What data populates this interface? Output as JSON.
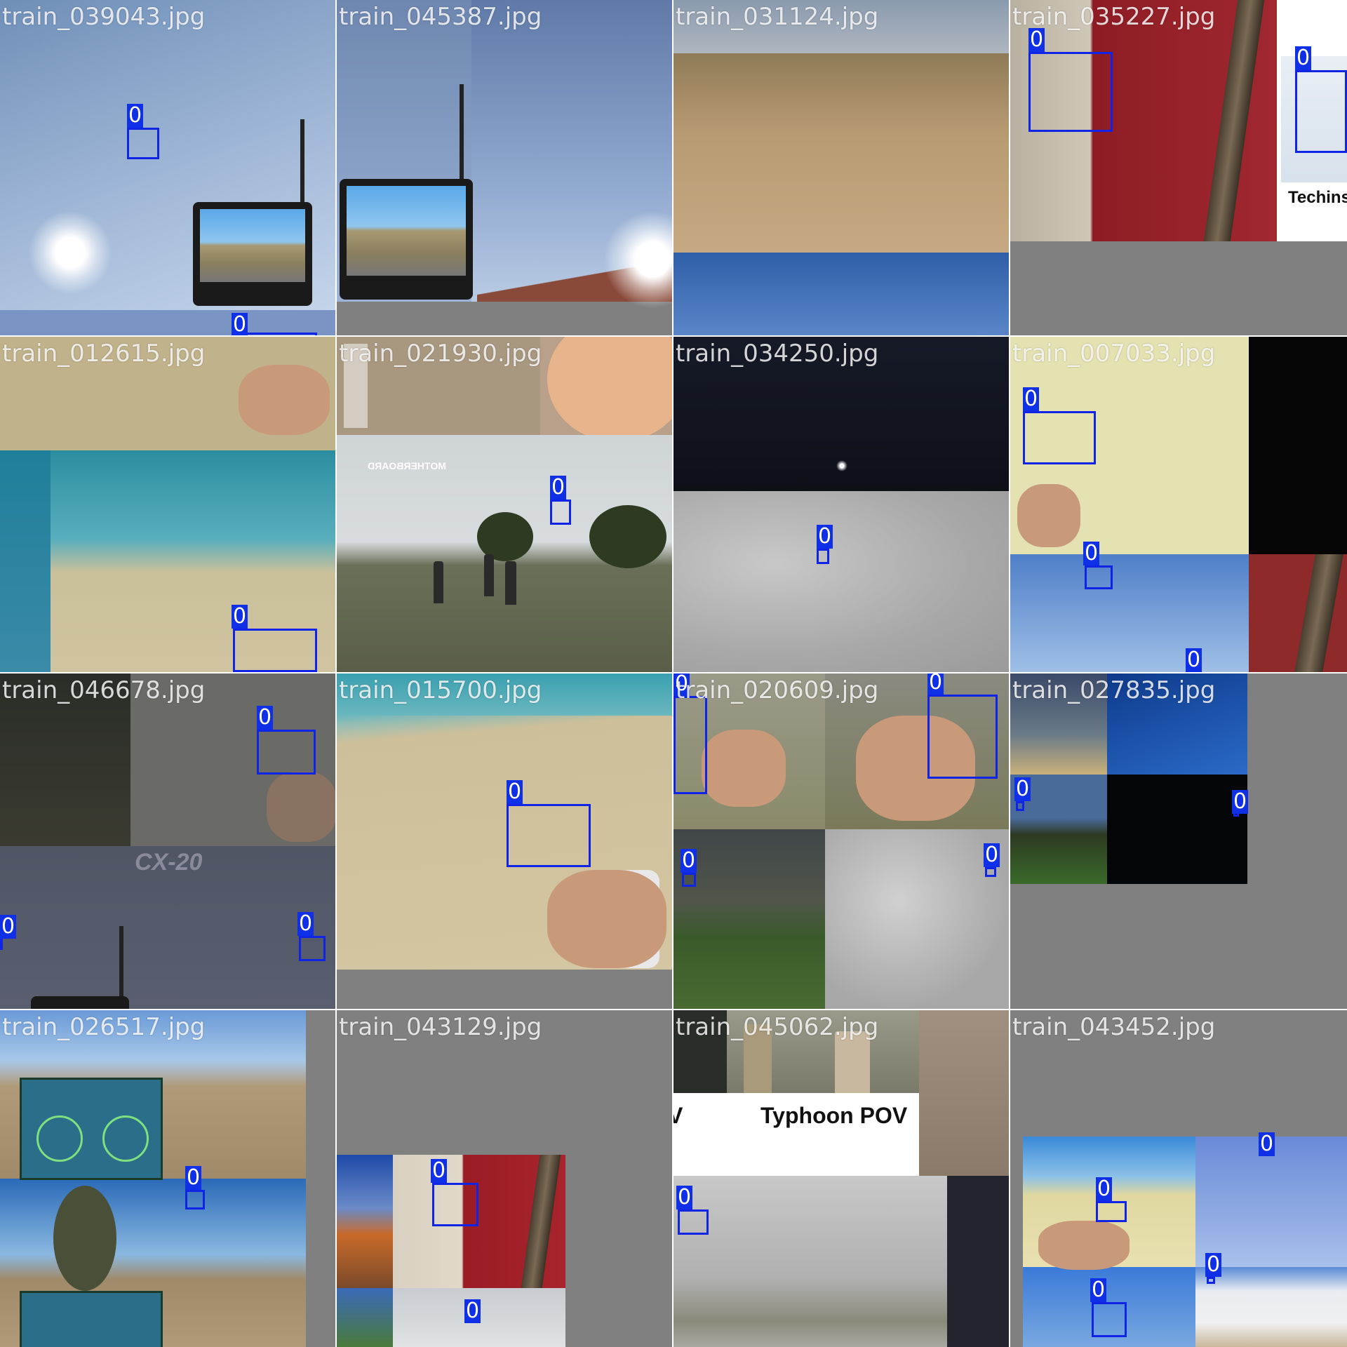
{
  "mosaic": {
    "box_color": "#1024e6",
    "tiles": [
      {
        "filename": "train_039043.jpg",
        "labels": [
          "0",
          "0"
        ]
      },
      {
        "filename": "train_045387.jpg",
        "labels": []
      },
      {
        "filename": "train_031124.jpg",
        "labels": []
      },
      {
        "filename": "train_035227.jpg",
        "labels": [
          "0",
          "0"
        ],
        "caption": "Techins"
      },
      {
        "filename": "train_012615.jpg",
        "labels": [
          "0"
        ]
      },
      {
        "filename": "train_021930.jpg",
        "labels": [
          "0"
        ],
        "overlay_text": "MOTHERBOARD"
      },
      {
        "filename": "train_034250.jpg",
        "labels": [
          "0"
        ]
      },
      {
        "filename": "train_007033.jpg",
        "labels": [
          "0",
          "0",
          "0"
        ]
      },
      {
        "filename": "train_046678.jpg",
        "labels": [
          "0",
          "0",
          "0"
        ],
        "overlay_text": "CX-20"
      },
      {
        "filename": "train_015700.jpg",
        "labels": [
          "0"
        ]
      },
      {
        "filename": "train_020609.jpg",
        "labels": [
          "0",
          "0",
          "0",
          "0"
        ]
      },
      {
        "filename": "train_027835.jpg",
        "labels": [
          "0",
          "0"
        ]
      },
      {
        "filename": "train_026517.jpg",
        "labels": [
          "0"
        ]
      },
      {
        "filename": "train_043129.jpg",
        "labels": [
          "0",
          "0"
        ]
      },
      {
        "filename": "train_045062.jpg",
        "labels": [
          "0"
        ],
        "caption": "Typhoon POV",
        "caption_left": "V"
      },
      {
        "filename": "train_043452.jpg",
        "labels": [
          "0",
          "0",
          "0",
          "0"
        ]
      }
    ]
  }
}
